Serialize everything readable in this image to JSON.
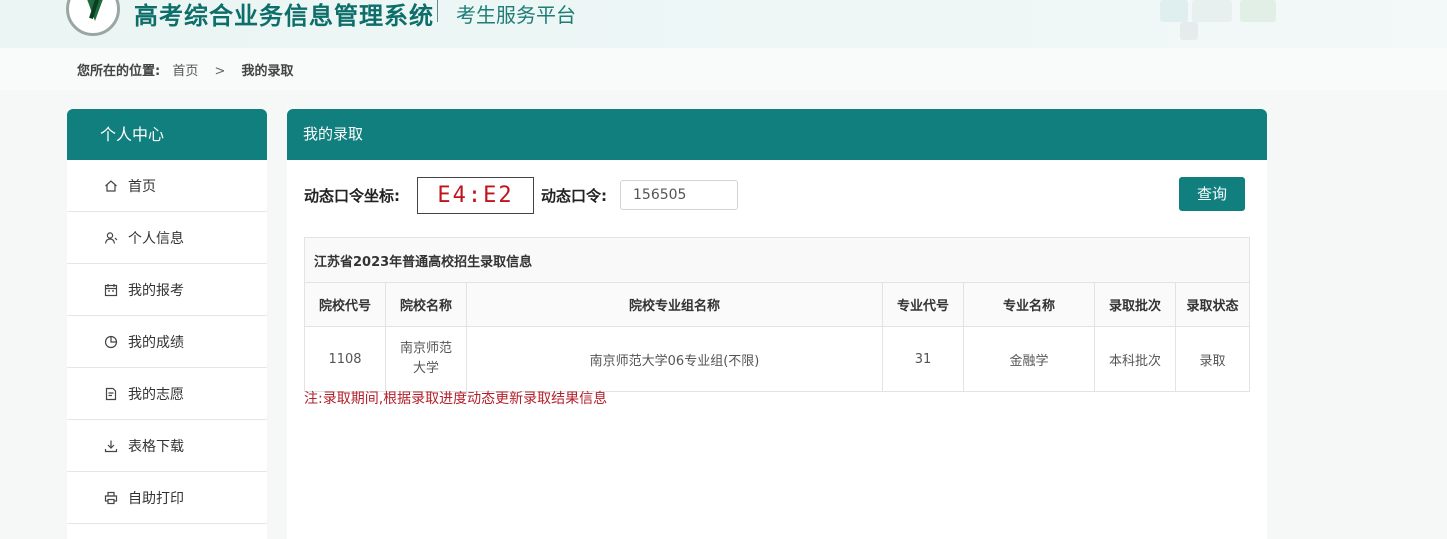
{
  "header": {
    "system_title": "高考综合业务信息管理系统",
    "sub_title": "考生服务平台"
  },
  "breadcrumb": {
    "label": "您所在的位置:",
    "home": "首页",
    "separator": ">",
    "current": "我的录取"
  },
  "sidebar": {
    "title": "个人中心",
    "items": [
      {
        "label": "首页",
        "icon": "home-icon"
      },
      {
        "label": "个人信息",
        "icon": "user-icon"
      },
      {
        "label": "我的报考",
        "icon": "calendar-icon"
      },
      {
        "label": "我的成绩",
        "icon": "pie-chart-icon"
      },
      {
        "label": "我的志愿",
        "icon": "document-icon"
      },
      {
        "label": "表格下载",
        "icon": "download-icon"
      },
      {
        "label": "自助打印",
        "icon": "printer-icon"
      }
    ]
  },
  "main": {
    "title": "我的录取",
    "coord_label": "动态口令坐标:",
    "coord_value": "E4:E2",
    "password_label": "动态口令:",
    "password_value": "156505",
    "query_button": "查询",
    "table": {
      "caption": "江苏省2023年普通高校招生录取信息",
      "headers": [
        "院校代号",
        "院校名称",
        "院校专业组名称",
        "专业代号",
        "专业名称",
        "录取批次",
        "录取状态"
      ],
      "rows": [
        [
          "1108",
          "南京师范大学",
          "南京师范大学06专业组(不限)",
          "31",
          "金融学",
          "本科批次",
          "录取"
        ]
      ]
    },
    "note": "注:录取期间,根据录取进度动态更新录取结果信息"
  },
  "colors": {
    "accent": "#107f7e",
    "note_red": "#b3202a",
    "coord_red": "#c0141c"
  }
}
